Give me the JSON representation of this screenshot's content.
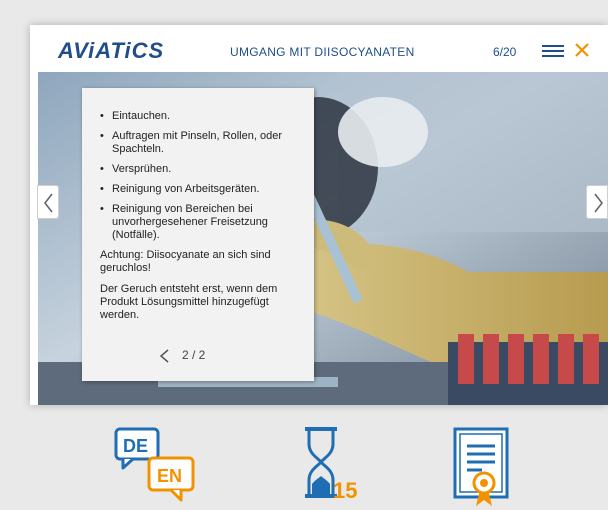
{
  "header": {
    "logo": "AViATiCS",
    "course_title": "UMGANG MIT DIISOCYANATEN",
    "progress": "6/20"
  },
  "icons": {
    "menu": "menu-icon",
    "close": "close-icon",
    "prev_slide": "chevron-left-icon",
    "next_slide": "chevron-right-icon",
    "language": "language-switch-icon",
    "timer": "hourglass-icon",
    "certificate": "certificate-icon"
  },
  "colors": {
    "brand_blue": "#1f4e8c",
    "accent_orange": "#f39200"
  },
  "textbox": {
    "bullets": [
      "Eintauchen.",
      "Auftragen mit Pinseln, Rollen, oder Spachteln.",
      "Versprühen.",
      "Reinigung von Arbeitsgeräten.",
      "Reinigung von Bereichen bei unvorhergesehener Freisetzung (Notfälle)."
    ],
    "note1": "Achtung: Diisocyanate an sich sind geruchlos!",
    "note2": "Der Geruch entsteht erst, wenn dem Produkt Lösungsmittel hinzugefügt werden.",
    "pager": "2 / 2"
  },
  "bottom": {
    "lang_from": "DE",
    "lang_to": "EN",
    "timer_value": "15"
  }
}
